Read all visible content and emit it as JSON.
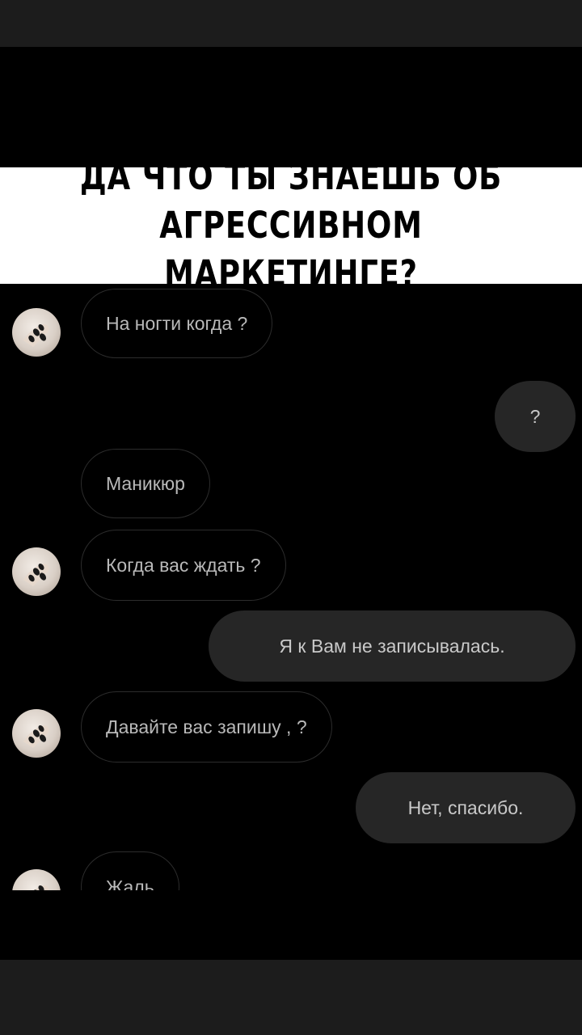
{
  "caption": {
    "text": "ДА ЧТО ТЫ ЗНАЕШЬ ОБ\nАГРЕССИВНОМ МАРКЕТИНГЕ?"
  },
  "chat": {
    "messages": [
      {
        "side": "in",
        "text": "На ногти когда ?"
      },
      {
        "side": "out",
        "text": "?"
      },
      {
        "side": "in",
        "text": "Маникюр"
      },
      {
        "side": "in",
        "text": "Когда вас ждать ?"
      },
      {
        "side": "out",
        "text": "Я к Вам не записывалась."
      },
      {
        "side": "in",
        "text": "Давайте вас запишу , ?"
      },
      {
        "side": "out",
        "text": "Нет, спасибо."
      },
      {
        "side": "in",
        "text": "Жаль"
      }
    ],
    "avatar_icon": "nails-photo-avatar"
  },
  "colors": {
    "background": "#000000",
    "bars": "#1c1c1c",
    "caption_bg": "#ffffff",
    "incoming_border": "#2c2c2c",
    "outgoing_bg": "#262626"
  }
}
